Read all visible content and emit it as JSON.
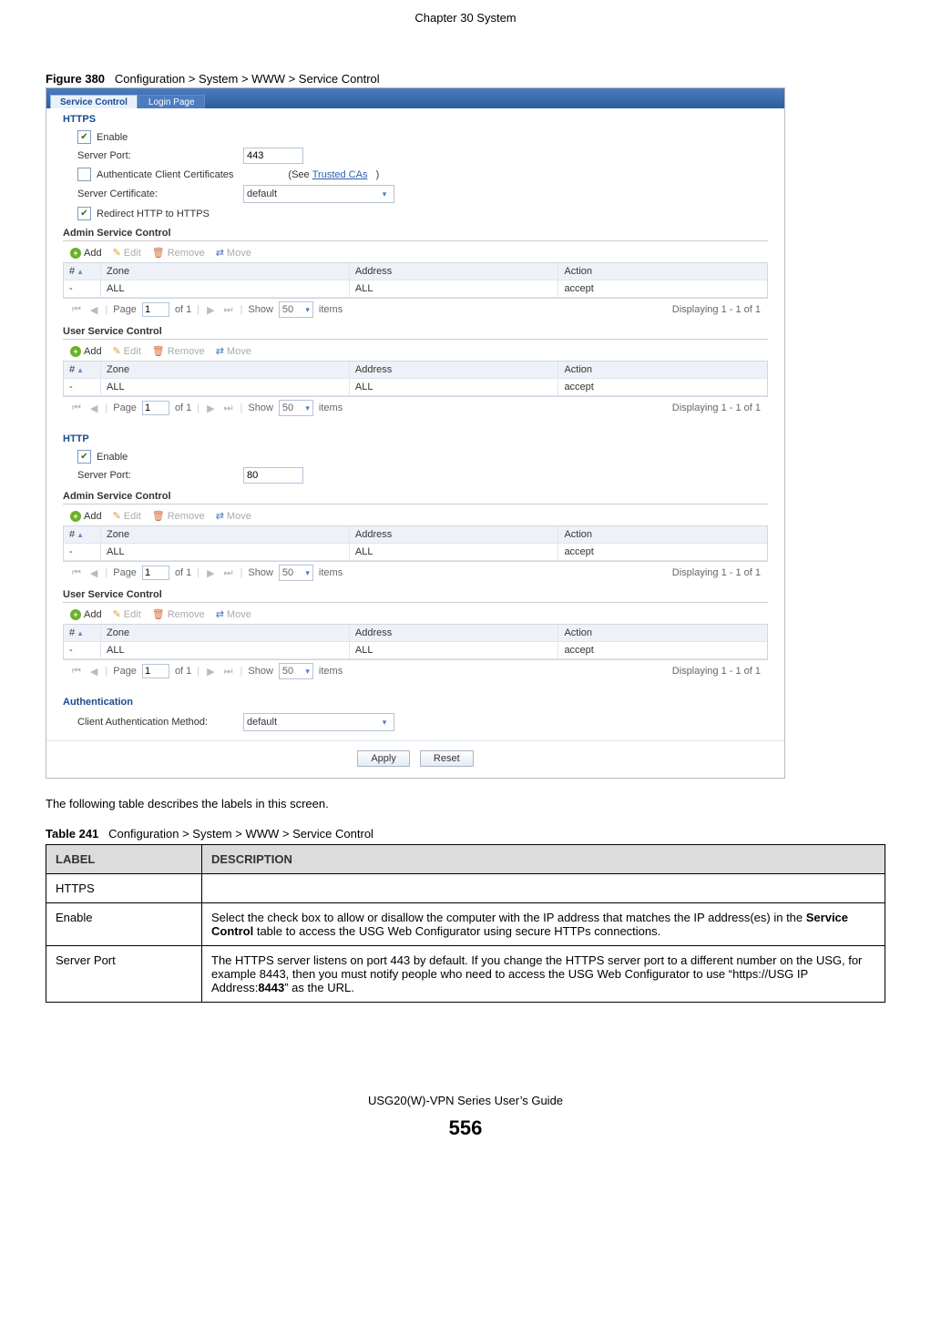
{
  "chapter_header": "Chapter 30 System",
  "figure_label": "Figure 380",
  "figure_title": "Configuration > System > WWW > Service Control",
  "tabs": {
    "active": "Service Control",
    "other": "Login Page"
  },
  "https": {
    "title": "HTTPS",
    "enable": "Enable",
    "server_port_lbl": "Server Port:",
    "server_port_val": "443",
    "auth_cc": "Authenticate Client Certificates",
    "see": "(See",
    "trusted": "Trusted CAs",
    "paren": ")",
    "server_cert_lbl": "Server Certificate:",
    "server_cert_val": "default",
    "redirect": "Redirect HTTP to HTTPS"
  },
  "http": {
    "title": "HTTP",
    "enable": "Enable",
    "server_port_lbl": "Server Port:",
    "server_port_val": "80"
  },
  "asc": {
    "title": "Admin Service Control"
  },
  "usc": {
    "title": "User Service Control"
  },
  "tb": {
    "add": "Add",
    "edit": "Edit",
    "remove": "Remove",
    "move": "Move"
  },
  "grid": {
    "hdr_idx": "#",
    "hdr_zone": "Zone",
    "hdr_addr": "Address",
    "hdr_act": "Action",
    "row_idx": "-",
    "row_zone": "ALL",
    "row_addr": "ALL",
    "row_act": "accept"
  },
  "pager": {
    "page": "Page",
    "pg_val": "1",
    "of": "of 1",
    "show": "Show",
    "show_val": "50",
    "items": "items",
    "disp": "Displaying 1 - 1 of 1"
  },
  "auth": {
    "title": "Authentication",
    "method_lbl": "Client Authentication Method:",
    "method_val": "default"
  },
  "buttons": {
    "apply": "Apply",
    "reset": "Reset"
  },
  "following": "The following table describes the labels in this screen.",
  "table_label": "Table 241",
  "table_title": "Configuration > System > WWW > Service Control",
  "th_label": "LABEL",
  "th_desc": "DESCRIPTION",
  "rows": [
    {
      "label": "HTTPS",
      "desc": ""
    },
    {
      "label": "Enable",
      "desc_a": "Select the check box to allow or disallow the computer with the IP address that matches the IP address(es) in the ",
      "desc_b": "Service Control",
      "desc_c": " table to access the USG Web Configurator using secure HTTPs connections."
    },
    {
      "label": "Server Port",
      "desc_a": "The HTTPS server listens on port 443 by default. If you change the HTTPS server port to a different number on the USG, for example 8443, then you must notify people who need to access the USG Web Configurator to use “https://USG IP Address:",
      "desc_b": "8443",
      "desc_c": "” as the URL."
    }
  ],
  "footer": "USG20(W)-VPN Series User’s Guide",
  "pagenum": "556"
}
